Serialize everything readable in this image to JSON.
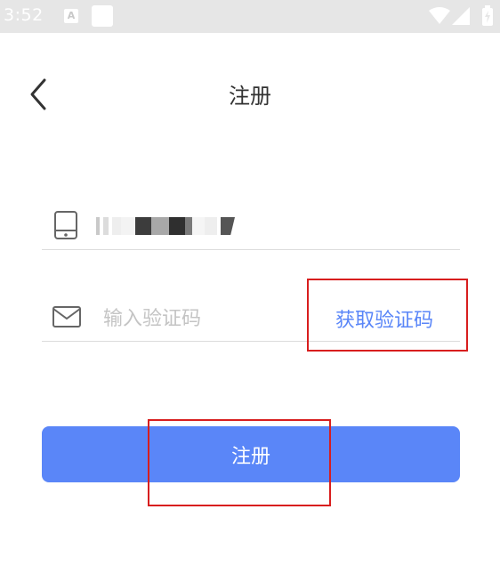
{
  "status_bar": {
    "time": "3:52",
    "indicator_letter": "A"
  },
  "header": {
    "title": "注册"
  },
  "form": {
    "phone_value_masked": true,
    "code_placeholder": "输入验证码",
    "code_value": "",
    "get_code_label": "获取验证码"
  },
  "actions": {
    "register_label": "注册"
  },
  "icons": {
    "back": "chevron-left-icon",
    "phone": "phone-icon",
    "mail": "mail-icon",
    "wifi": "wifi-icon",
    "signal": "signal-icon",
    "battery": "battery-icon"
  },
  "colors": {
    "accent": "#5a86f8",
    "link": "#5a86f8",
    "annotation": "#d81e1e",
    "status_bar": "#e6e6e6"
  }
}
